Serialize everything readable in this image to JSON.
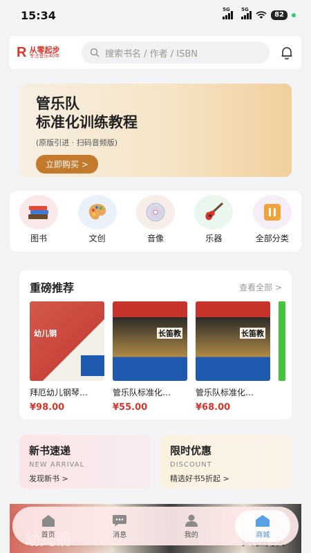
{
  "status": {
    "time": "15:34",
    "signal1": "5G",
    "signal2": "5G",
    "battery": "82"
  },
  "header": {
    "logo_letter": "R",
    "logo_main": "从零起步",
    "logo_sub": "专注音乐40年",
    "search_placeholder": "搜索书名 / 作者 / ISBN"
  },
  "banner": {
    "title_line1": "管乐队",
    "title_line2": "标准化训练教程",
    "subtitle": "(原版引进 · 扫码音频版)",
    "button": "立即购买 >"
  },
  "categories": [
    {
      "label": "图书",
      "icon": "books-icon"
    },
    {
      "label": "文创",
      "icon": "palette-icon"
    },
    {
      "label": "音像",
      "icon": "disc-icon"
    },
    {
      "label": "乐器",
      "icon": "guitar-icon"
    },
    {
      "label": "全部分类",
      "icon": "grid-icon"
    }
  ],
  "featured": {
    "title": "重磅推荐",
    "more": "查看全部 >",
    "products": [
      {
        "name": "拜厄幼儿钢琴…",
        "price": "¥98.00",
        "cover_text": "幼儿钢"
      },
      {
        "name": "管乐队标准化…",
        "price": "¥55.00",
        "cover_text": "长笛教"
      },
      {
        "name": "管乐队标准化…",
        "price": "¥68.00",
        "cover_text": "长笛教"
      }
    ]
  },
  "promos": {
    "new": {
      "title": "新书速递",
      "en": "NEW ARRIVAL",
      "link": "发现新书 >"
    },
    "sale": {
      "title": "限时优惠",
      "en": "DISCOUNT",
      "link": "精选好书5折起 >"
    }
  },
  "tabbar": [
    {
      "label": "首页",
      "icon": "home-icon"
    },
    {
      "label": "消息",
      "icon": "chat-icon"
    },
    {
      "label": "我的",
      "icon": "user-icon"
    },
    {
      "label": "商城",
      "icon": "store-icon",
      "active": true
    }
  ]
}
